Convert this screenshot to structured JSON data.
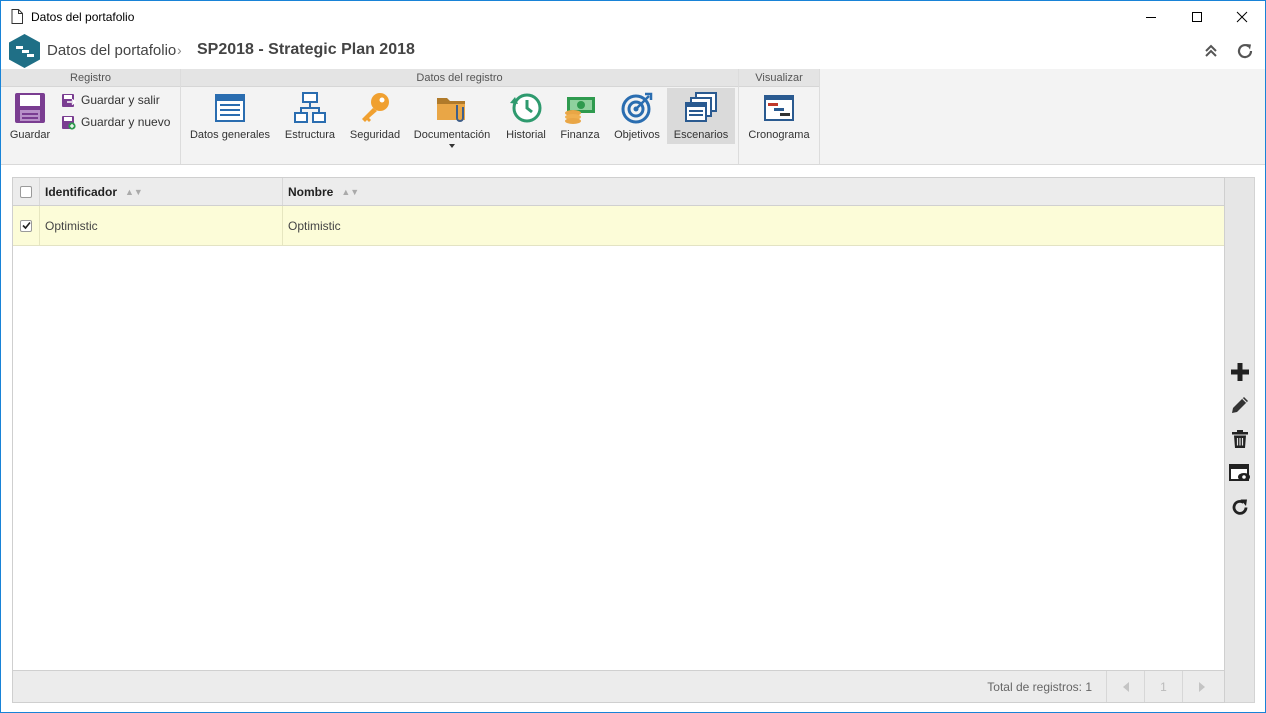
{
  "window": {
    "title": "Datos del portafolio"
  },
  "header": {
    "breadcrumb_root": "Datos del portafolio",
    "separator": "›",
    "record_title": "SP2018 - Strategic Plan 2018"
  },
  "ribbon": {
    "groups": {
      "registro": "Registro",
      "datos_registro": "Datos del registro",
      "visualizar": "Visualizar"
    },
    "buttons": {
      "guardar": "Guardar",
      "guardar_salir": "Guardar y salir",
      "guardar_nuevo": "Guardar y nuevo",
      "datos_generales": "Datos generales",
      "estructura": "Estructura",
      "seguridad": "Seguridad",
      "documentacion": "Documentación",
      "historial": "Historial",
      "finanza": "Finanza",
      "objetivos": "Objetivos",
      "escenarios": "Escenarios",
      "cronograma": "Cronograma"
    },
    "active_button": "Escenarios"
  },
  "grid": {
    "columns": [
      "Identificador",
      "Nombre"
    ],
    "rows": [
      {
        "identificador": "Optimistic",
        "nombre": "Optimistic",
        "checked": true
      }
    ],
    "footer": {
      "total_label": "Total de registros: 1",
      "page": "1"
    }
  },
  "colors": {
    "accent": "#1883d7",
    "logo_teal": "#1f6f86",
    "selected_row": "#fcfcd8",
    "ribbon_bg": "#f3f3f3"
  }
}
